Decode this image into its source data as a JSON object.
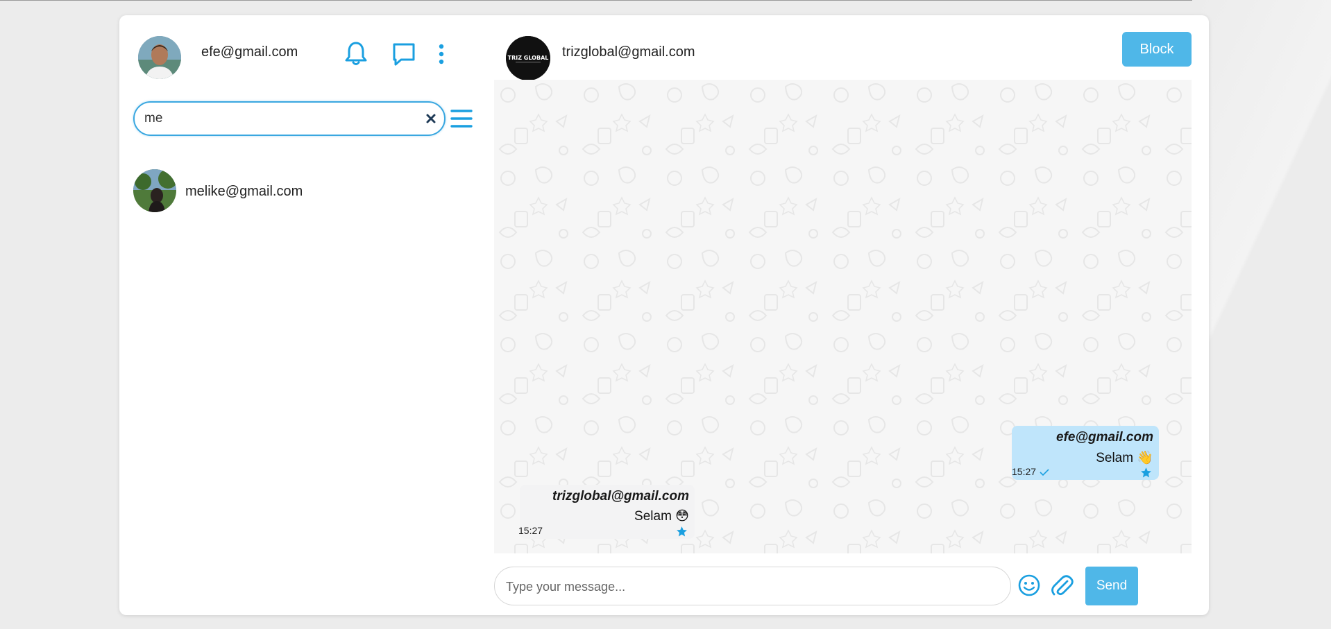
{
  "user": {
    "email": "efe@gmail.com"
  },
  "search": {
    "value": "me",
    "placeholder": ""
  },
  "contacts": [
    {
      "email": "melike@gmail.com"
    }
  ],
  "chat": {
    "peer_email": "trizglobal@gmail.com",
    "peer_avatar_text": "TRIZ GLOBAL",
    "block_label": "Block",
    "messages": [
      {
        "sender": "efe@gmail.com",
        "text": "Selam 👋",
        "time": "15:27",
        "direction": "outgoing",
        "read": true,
        "starred": true
      },
      {
        "sender": "trizglobal@gmail.com",
        "text": "Selam 😳",
        "time": "15:27",
        "direction": "incoming",
        "starred": true
      }
    ],
    "composer": {
      "placeholder": "Type your message...",
      "send_label": "Send"
    }
  },
  "icons": {
    "notifications": "bell-icon",
    "chats": "chat-bubble-icon",
    "more": "kebab-menu-icon",
    "clear": "close-icon",
    "filter": "hamburger-menu-icon",
    "emoji": "smiley-icon",
    "attach": "paperclip-icon",
    "star": "star-icon",
    "read": "checkmark-icon"
  },
  "colors": {
    "accent": "#1a9fe0",
    "button": "#4fb7e8",
    "outgoing_bubble": "#bfe5fb",
    "chat_bg": "#f6f6f6"
  }
}
